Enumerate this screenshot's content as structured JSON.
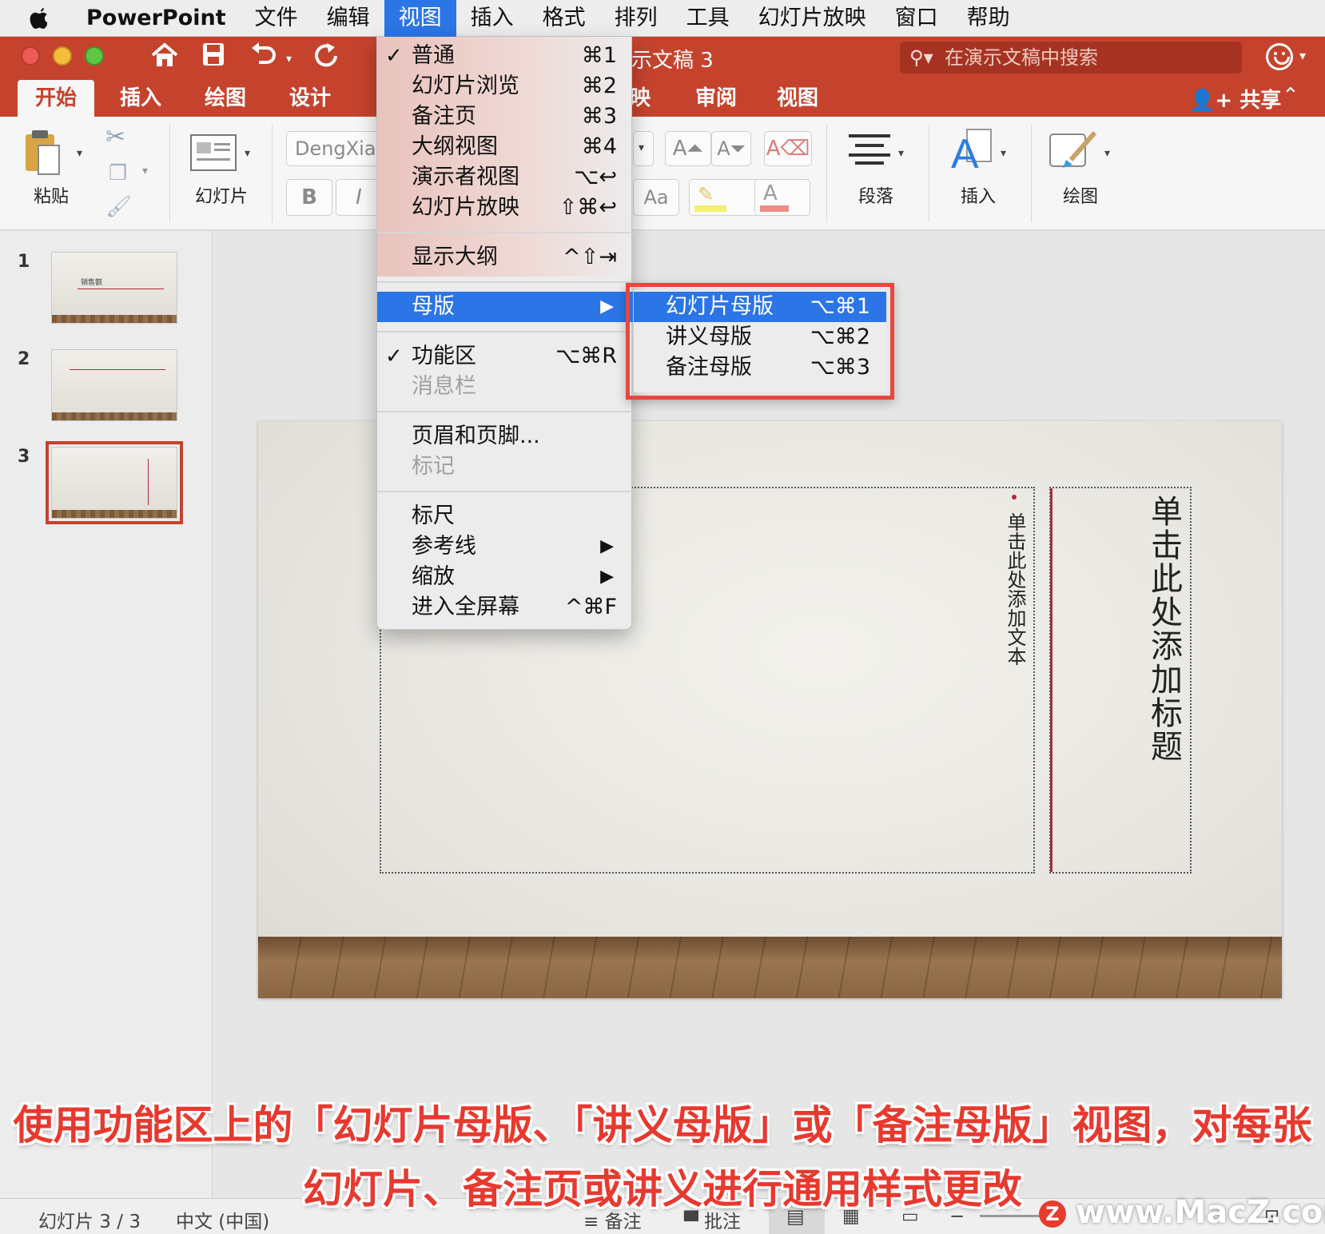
{
  "menubar": {
    "app": "PowerPoint",
    "items": [
      "文件",
      "编辑",
      "视图",
      "插入",
      "格式",
      "排列",
      "工具",
      "幻灯片放映",
      "窗口",
      "帮助"
    ],
    "active_index": 2
  },
  "titlebar": {
    "doc_title": "示文稿 3",
    "search_placeholder": "在演示文稿中搜索",
    "share_label": "共享"
  },
  "ribbon_tabs": [
    "开始",
    "插入",
    "绘图",
    "设计",
    "映",
    "审阅",
    "视图"
  ],
  "ribbon": {
    "paste": "粘贴",
    "slides": "幻灯片",
    "font_name": "DengXian",
    "bold": "B",
    "italic": "I",
    "paragraph": "段落",
    "insert": "插入",
    "draw": "绘图"
  },
  "slides": [
    {
      "number": "1",
      "title": "销售额"
    },
    {
      "number": "2",
      "title": ""
    },
    {
      "number": "3",
      "title": ""
    }
  ],
  "view_menu": {
    "items": [
      {
        "label": "普通",
        "shortcut": "⌘1",
        "checked": true
      },
      {
        "label": "幻灯片浏览",
        "shortcut": "⌘2"
      },
      {
        "label": "备注页",
        "shortcut": "⌘3"
      },
      {
        "label": "大纲视图",
        "shortcut": "⌘4"
      },
      {
        "label": "演示者视图",
        "shortcut": "⌥↩"
      },
      {
        "label": "幻灯片放映",
        "shortcut": "⇧⌘↩"
      },
      {
        "label": "显示大纲",
        "shortcut": "^⇧⇥"
      },
      {
        "label": "母版",
        "shortcut": "▶"
      },
      {
        "label": "功能区",
        "shortcut": "⌥⌘R",
        "checked": true
      },
      {
        "label": "消息栏",
        "shortcut": ""
      },
      {
        "label": "页眉和页脚...",
        "shortcut": ""
      },
      {
        "label": "标记",
        "shortcut": ""
      },
      {
        "label": "标尺",
        "shortcut": ""
      },
      {
        "label": "参考线",
        "shortcut": "▶"
      },
      {
        "label": "缩放",
        "shortcut": "▶"
      },
      {
        "label": "进入全屏幕",
        "shortcut": "^⌘F"
      }
    ],
    "check_mark": "✓"
  },
  "master_submenu": [
    {
      "label": "幻灯片母版",
      "shortcut": "⌥⌘1"
    },
    {
      "label": "讲义母版",
      "shortcut": "⌥⌘2"
    },
    {
      "label": "备注母版",
      "shortcut": "⌥⌘3"
    }
  ],
  "slide_content": {
    "title_placeholder": "单击此处添加标题",
    "text_placeholder": "单击此处添加文本"
  },
  "statusbar": {
    "slide_counter": "幻灯片 3 / 3",
    "language": "中文 (中国)",
    "notes": "备注",
    "comments": "批注"
  },
  "caption": {
    "line1": "使用功能区上的「幻灯片母版、「讲义母版」或「备注母版」视图，对每张",
    "line2": "幻灯片、备注页或讲义进行通用样式更改"
  },
  "watermark": "www.MacZ.com",
  "colors": {
    "titlebar": "#c5432d",
    "menu_highlight": "#2b75e6",
    "callout_frame": "#e8473d",
    "caption_text": "#e8392f"
  }
}
